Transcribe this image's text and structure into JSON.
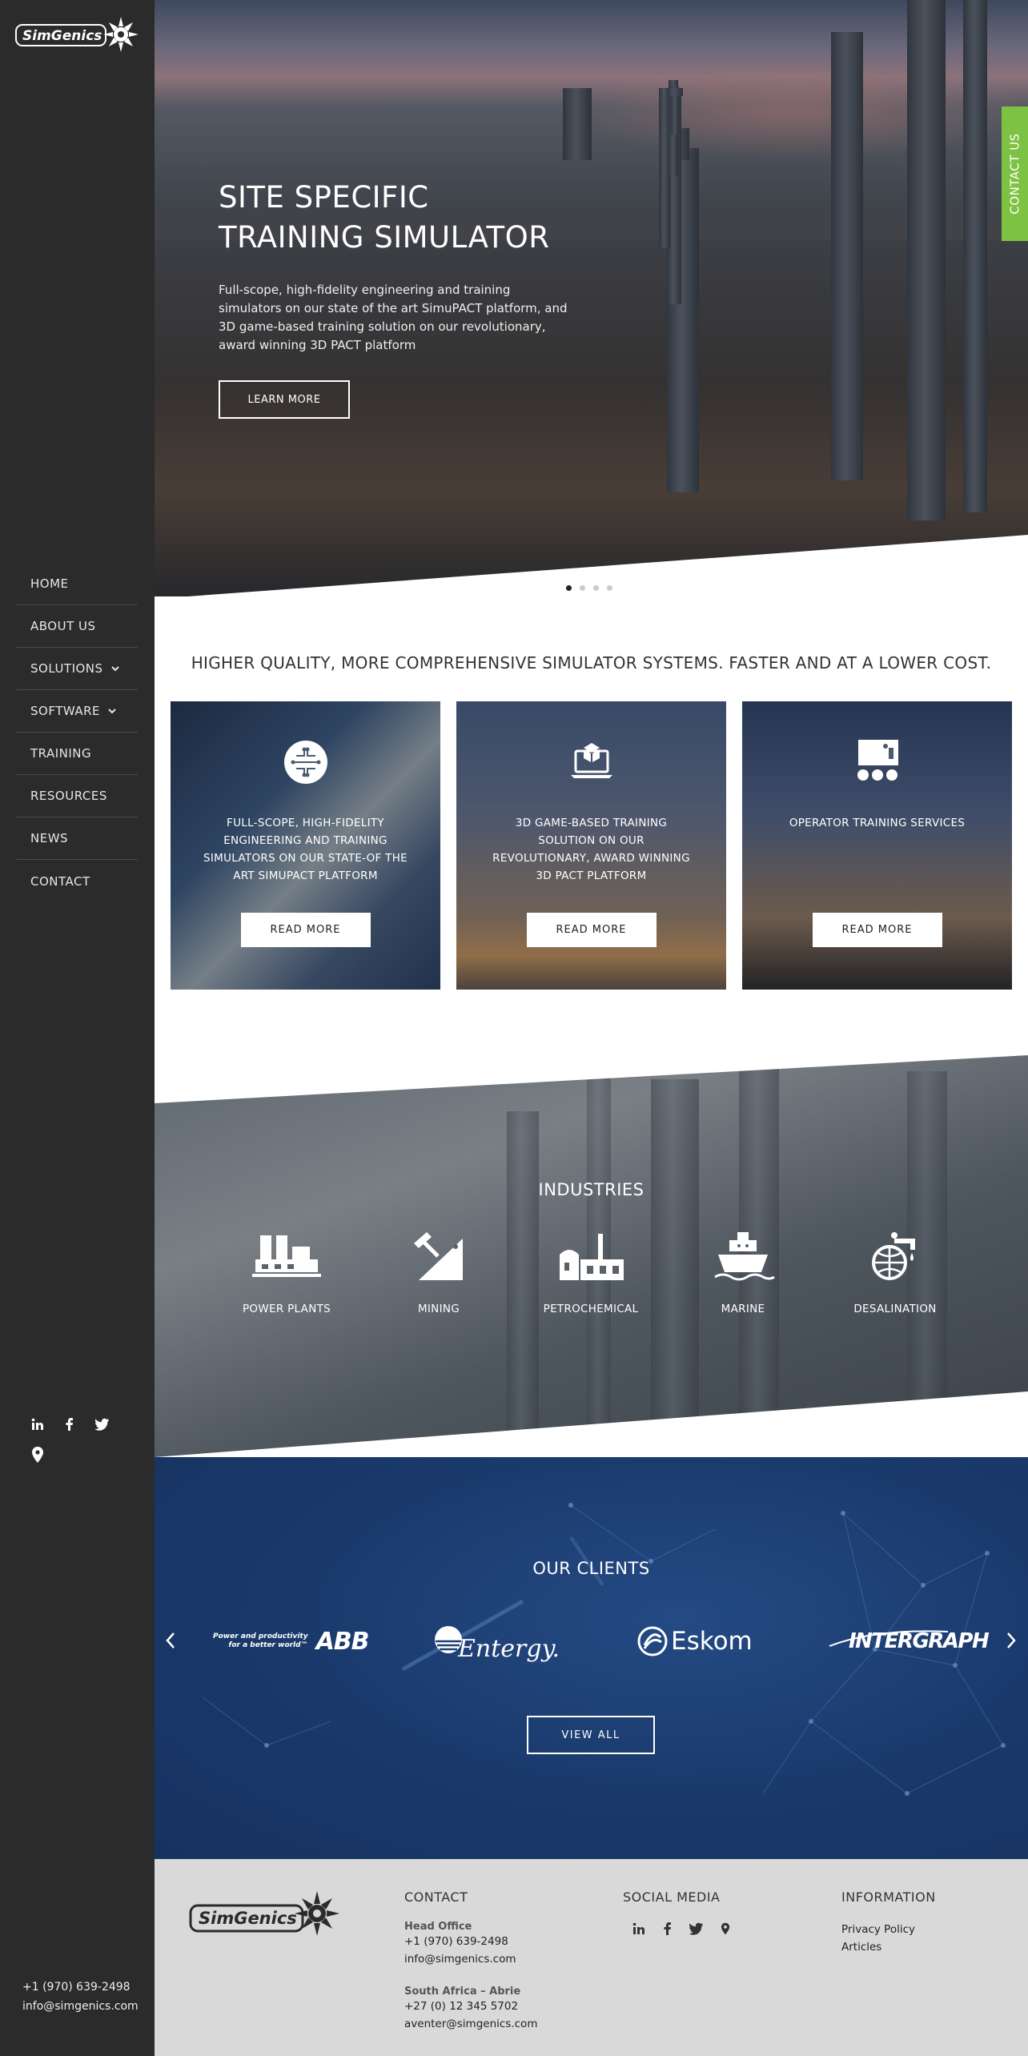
{
  "brand": {
    "name": "SimGenics"
  },
  "sidebar": {
    "nav": [
      {
        "label": "HOME",
        "dropdown": false
      },
      {
        "label": "ABOUT US",
        "dropdown": false
      },
      {
        "label": "SOLUTIONS",
        "dropdown": true
      },
      {
        "label": "SOFTWARE",
        "dropdown": true
      },
      {
        "label": "TRAINING",
        "dropdown": false
      },
      {
        "label": "RESOURCES",
        "dropdown": false
      },
      {
        "label": "NEWS",
        "dropdown": false
      },
      {
        "label": "CONTACT",
        "dropdown": false
      }
    ],
    "social_icons": [
      "linkedin-icon",
      "facebook-icon",
      "twitter-icon",
      "map-pin-icon"
    ],
    "phone": "+1 (970) 639-2498",
    "email": "info@simgenics.com"
  },
  "hero": {
    "title_line1": "SITE SPECIFIC",
    "title_line2": "TRAINING SIMULATOR",
    "text": "Full-scope, high-fidelity engineering and training simulators on our state of the art SimuPACT platform, and 3D game-based training solution on our revolutionary, award winning 3D PACT platform",
    "button": "LEARN MORE",
    "slides": 4,
    "active_slide": 1
  },
  "contact_tab": "CONTACT US",
  "tagline": "HIGHER QUALITY, MORE COMPREHENSIVE SIMULATOR SYSTEMS. FASTER AND AT A LOWER COST.",
  "cards": [
    {
      "icon": "circuit-brain-icon",
      "text": "FULL-SCOPE, HIGH-FIDELITY ENGINEERING AND TRAINING SIMULATORS ON OUR STATE-OF THE ART SIMUPACT PLATFORM",
      "button": "READ MORE"
    },
    {
      "icon": "laptop-cube-icon",
      "text": "3D GAME-BASED TRAINING SOLUTION ON OUR REVOLUTIONARY, AWARD WINNING 3D PACT PLATFORM",
      "button": "READ MORE"
    },
    {
      "icon": "classroom-icon",
      "text": "OPERATOR TRAINING SERVICES",
      "button": "READ MORE"
    }
  ],
  "industries": {
    "title": "INDUSTRIES",
    "items": [
      {
        "label": "POWER PLANTS",
        "icon": "power-plant-icon"
      },
      {
        "label": "MINING",
        "icon": "mining-icon"
      },
      {
        "label": "PETROCHEMICAL",
        "icon": "petrochemical-icon"
      },
      {
        "label": "MARINE",
        "icon": "marine-icon"
      },
      {
        "label": "DESALINATION",
        "icon": "desalination-icon"
      }
    ]
  },
  "clients": {
    "title": "OUR CLIENTS",
    "abb_tagline_1": "Power and productivity",
    "abb_tagline_2": "for a better world™",
    "logos": [
      "ABB",
      "Entergy.",
      "Eskom",
      "INTERGRAPH"
    ],
    "button": "VIEW ALL"
  },
  "footer": {
    "contact": {
      "heading": "CONTACT",
      "head_office_label": "Head Office",
      "head_office_phone": "+1 (970) 639-2498",
      "head_office_email": "info@simgenics.com",
      "sa_label": "South Africa – Abrie",
      "sa_phone": "+27 (0) 12 345 5702",
      "sa_email": "aventer@simgenics.com"
    },
    "social": {
      "heading": "SOCIAL MEDIA"
    },
    "information": {
      "heading": "INFORMATION",
      "links": [
        "Privacy Policy",
        "Articles"
      ]
    }
  },
  "colors": {
    "sidebar": "#2b2b2b",
    "accent_green": "#7dc242",
    "clients_blue": "#1a3a6c",
    "footer": "#d9d9d9"
  }
}
